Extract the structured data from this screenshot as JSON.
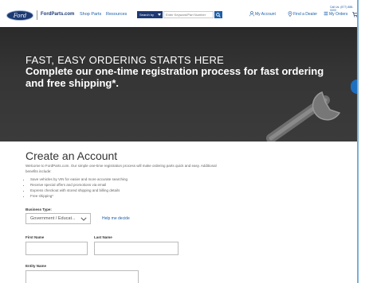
{
  "header": {
    "logo_text": "Ford",
    "brand": "FordParts.com",
    "nav": [
      "Shop Parts",
      "Resources"
    ],
    "search_by_label": "Search by",
    "search_placeholder": "Enter Keyword/Part Number",
    "call_us": "Call Us: (877) 888-0000",
    "my_account": "My Account",
    "find_dealer": "Find a Dealer",
    "my_orders": "My Orders"
  },
  "hero": {
    "line1": "FAST, EASY ORDERING STARTS HERE",
    "line2": "Complete our one-time registration process for fast ordering and free shipping*."
  },
  "form": {
    "title": "Create an Account",
    "intro": "Welcome to FordParts.com. Our simple one-time registration process will make ordering parts quick and easy. Additional benefits include:",
    "bullets": [
      "Save vehicles by VIN for easier and more accurate searching",
      "Receive special offers and promotions via email",
      "Express checkout with stored shipping and billing details",
      "Free shipping*"
    ],
    "business_type_label": "Business Type:",
    "business_type_value": "Government / Educat...",
    "help_link": "Help me decide",
    "first_name_label": "First Name",
    "last_name_label": "Last Name",
    "entity_name_label": "Entity Name"
  },
  "colors": {
    "brand_blue": "#1d3a73",
    "link_blue": "#1d5fa8"
  }
}
